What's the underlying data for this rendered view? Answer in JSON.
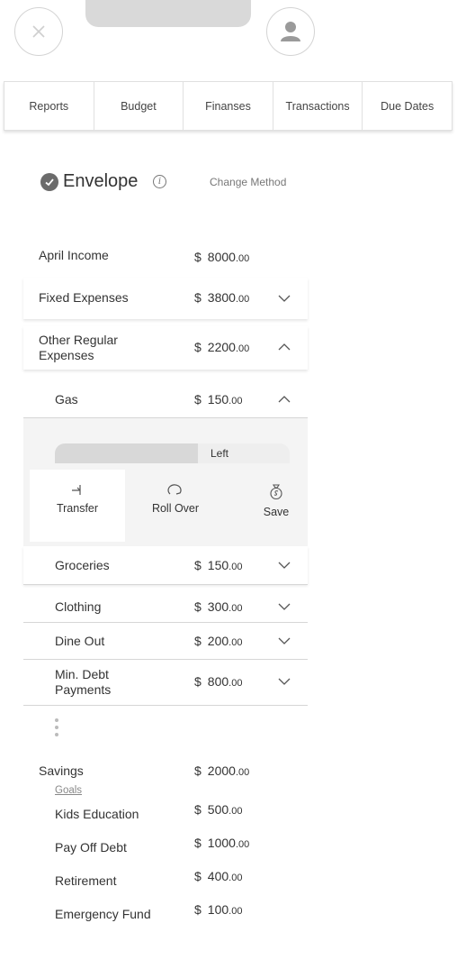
{
  "tabs": [
    "Reports",
    "Budget",
    "Finanses",
    "Transactions",
    "Due Dates"
  ],
  "method": {
    "title": "Envelope",
    "change_label": "Change Method"
  },
  "income": {
    "label": "April Income",
    "currency": "$",
    "whole": "8000",
    "cents": ".00"
  },
  "fixed": {
    "label": "Fixed Expenses",
    "currency": "$",
    "whole": "3800",
    "cents": ".00"
  },
  "other_regular": {
    "label_line1": "Other Regular",
    "label_line2": "Expenses",
    "currency": "$",
    "whole": "2200",
    "cents": ".00"
  },
  "gas": {
    "label": "Gas",
    "currency": "$",
    "whole": "150",
    "cents": ".00",
    "used_fraction": 0.61,
    "left_label": "Left",
    "actions": [
      "Transfer",
      "Roll Over",
      "Save"
    ]
  },
  "categories": [
    {
      "label": "Groceries",
      "currency": "$",
      "whole": "150",
      "cents": ".00"
    },
    {
      "label": "Clothing",
      "currency": "$",
      "whole": "300",
      "cents": ".00"
    },
    {
      "label": "Dine Out",
      "currency": "$",
      "whole": "200",
      "cents": ".00"
    },
    {
      "label_line1": "Min. Debt",
      "label_line2": "Payments",
      "currency": "$",
      "whole": "800",
      "cents": ".00"
    }
  ],
  "savings": {
    "label": "Savings",
    "currency": "$",
    "whole": "2000",
    "cents": ".00",
    "goals_label": "Goals",
    "goals": [
      {
        "label": "Kids Education",
        "currency": "$",
        "whole": "500",
        "cents": ".00"
      },
      {
        "label": "Pay Off Debt",
        "currency": "$",
        "whole": "1000",
        "cents": ".00"
      },
      {
        "label": "Retirement",
        "currency": "$",
        "whole": "400",
        "cents": ".00"
      },
      {
        "label": "Emergency Fund",
        "currency": "$",
        "whole": "100",
        "cents": ".00"
      }
    ]
  },
  "colors": {
    "accent_gray": "#6b6b6b",
    "panel_bg": "#f4f4f4",
    "bar_used": "#d8d8d8"
  }
}
